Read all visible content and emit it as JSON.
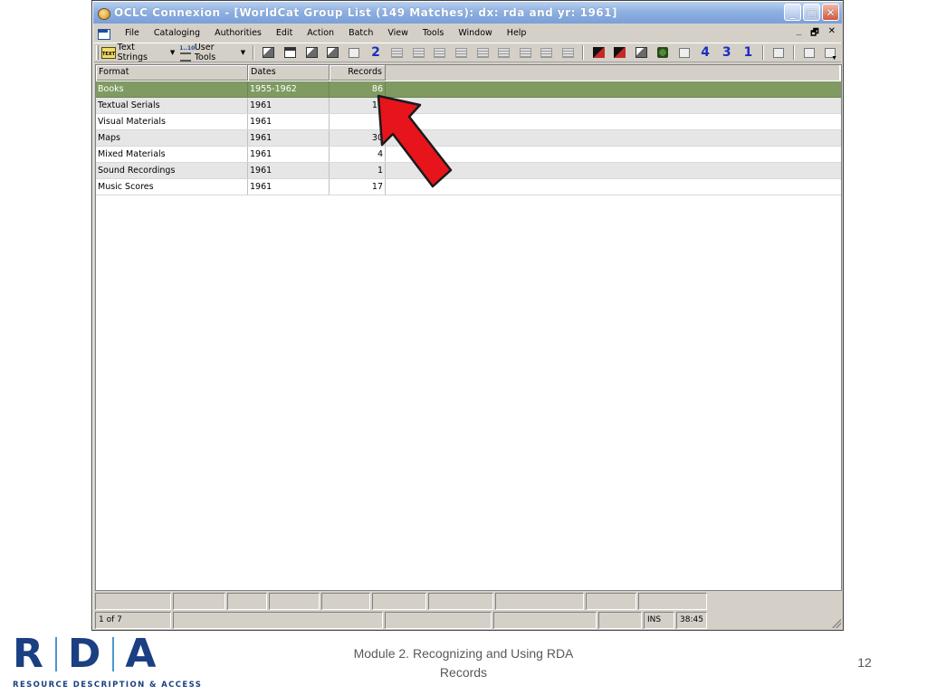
{
  "window": {
    "title": "OCLC Connexion - [WorldCat Group List (149 Matches): dx: rda and yr: 1961]",
    "controls": {
      "minimize": "_",
      "maximize": "□",
      "close": "✕"
    }
  },
  "menubar": {
    "items": [
      "File",
      "Cataloging",
      "Authorities",
      "Edit",
      "Action",
      "Batch",
      "View",
      "Tools",
      "Window",
      "Help"
    ],
    "mdi_controls": {
      "minimize": "_",
      "restore": "🗗",
      "close": "✕"
    }
  },
  "toolbar": {
    "text_strings_label": "Text Strings",
    "user_tools_label": "User Tools",
    "numbers": [
      "2",
      "4",
      "3",
      "1"
    ]
  },
  "grid": {
    "headers": {
      "format": "Format",
      "dates": "Dates",
      "records": "Records"
    },
    "rows": [
      {
        "format": "Books",
        "dates": "1955-1962",
        "records": "86"
      },
      {
        "format": "Textual Serials",
        "dates": "1961",
        "records": "10"
      },
      {
        "format": "Visual Materials",
        "dates": "1961",
        "records": ""
      },
      {
        "format": "Maps",
        "dates": "1961",
        "records": "30"
      },
      {
        "format": "Mixed Materials",
        "dates": "1961",
        "records": "4"
      },
      {
        "format": "Sound Recordings",
        "dates": "1961",
        "records": "1"
      },
      {
        "format": "Music Scores",
        "dates": "1961",
        "records": "17"
      }
    ]
  },
  "statusbar": {
    "position": "1 of 7",
    "mode": "INS",
    "time": "38:45"
  },
  "slide": {
    "logo_text": "RDA",
    "logo_tagline": "RESOURCE DESCRIPTION & ACCESS",
    "caption_line1": "Module 2. Recognizing and Using RDA",
    "caption_line2": "Records",
    "page_number": "12"
  },
  "colors": {
    "selected_row": "#7f9b62",
    "arrow": "#e8141b",
    "logo": "#1b3f83"
  }
}
